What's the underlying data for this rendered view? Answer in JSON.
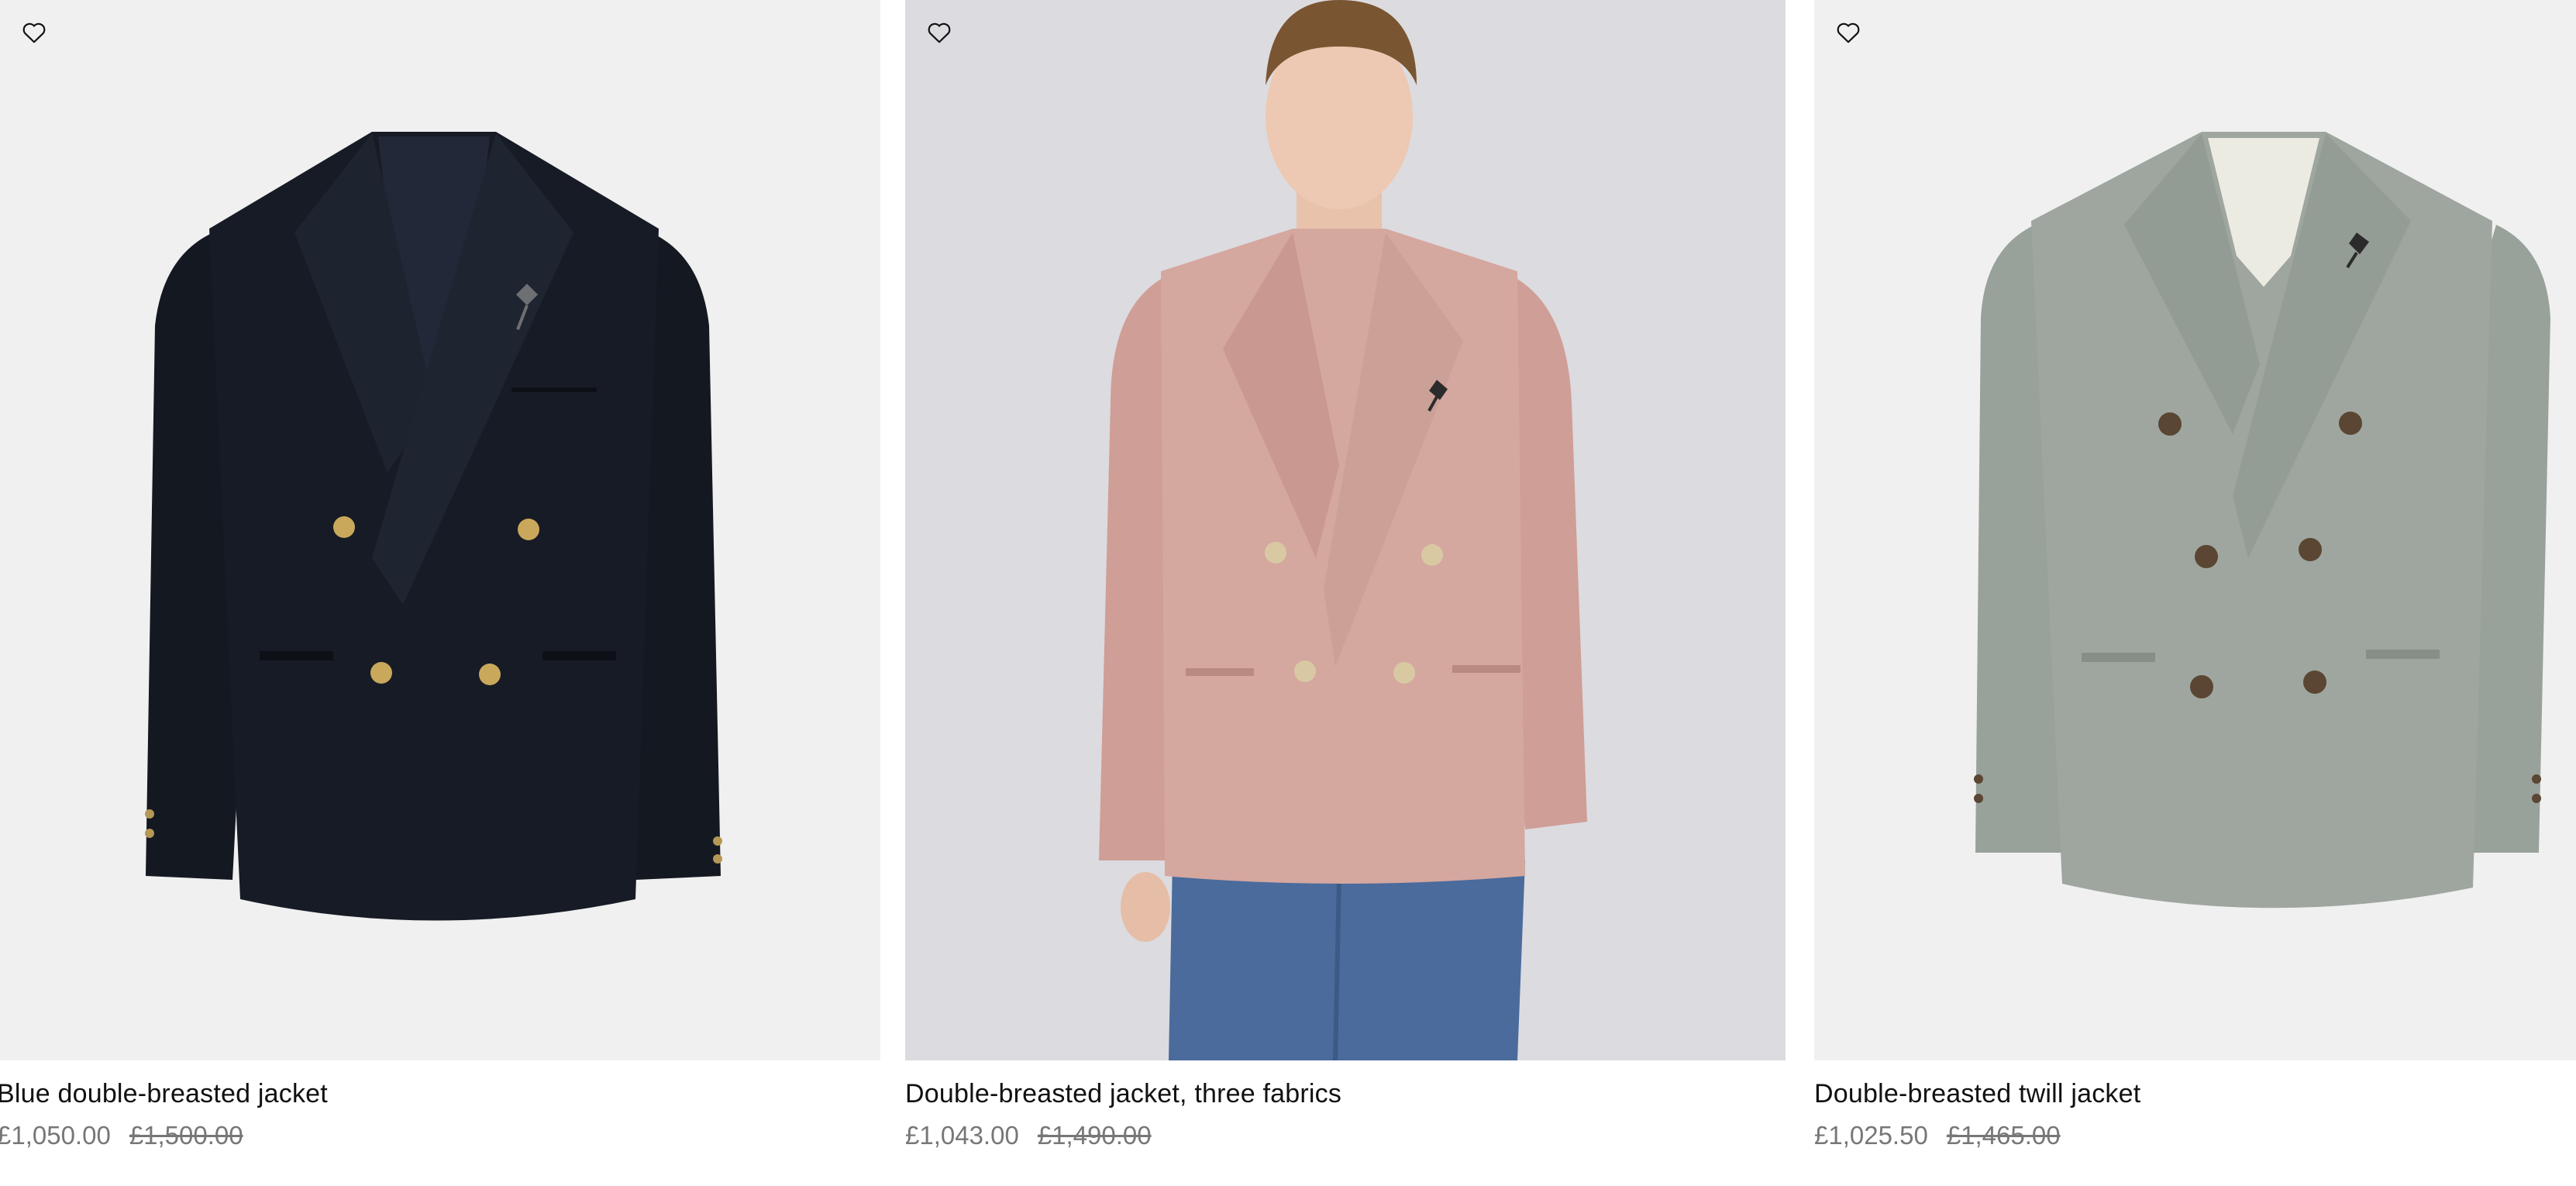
{
  "products": [
    {
      "name": "Blue double-breasted jacket",
      "price": "£1,050.00",
      "original_price": "£1,500.00",
      "wishlist_icon": "heart-outline-icon",
      "image": "navy double-breasted blazer on light grey background"
    },
    {
      "name": "Double-breasted jacket, three fabrics",
      "price": "£1,043.00",
      "original_price": "£1,490.00",
      "wishlist_icon": "heart-outline-icon",
      "image": "model wearing pink double-breasted jacket with jeans"
    },
    {
      "name": "Double-breasted twill jacket",
      "price": "£1,025.50",
      "original_price": "£1,465.00",
      "wishlist_icon": "heart-outline-icon",
      "image": "sage grey double-breasted twill jacket on light grey background"
    }
  ],
  "colors": {
    "navy": "#161a24",
    "pink": "#d3a59d",
    "sage": "#9aa39c",
    "price_text": "#777777"
  }
}
